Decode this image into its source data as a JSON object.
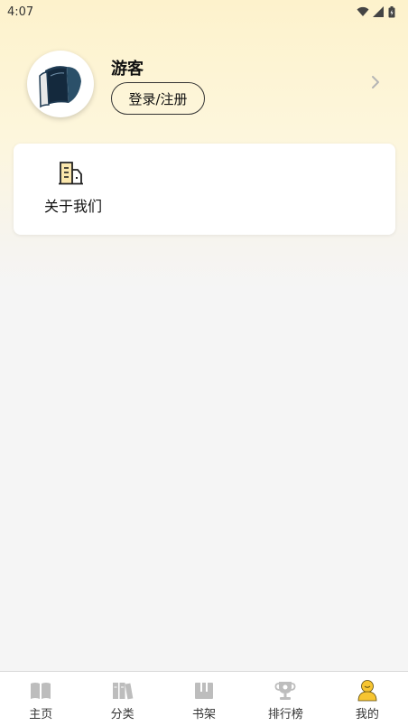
{
  "status_bar": {
    "time": "4:07"
  },
  "profile": {
    "username": "游客",
    "login_label": "登录/注册"
  },
  "menu": {
    "about_label": "关于我们"
  },
  "tabbar": {
    "tabs": [
      {
        "label": "主页",
        "icon": "book-open-icon",
        "active": false
      },
      {
        "label": "分类",
        "icon": "category-books-icon",
        "active": false
      },
      {
        "label": "书架",
        "icon": "bookshelf-icon",
        "active": false
      },
      {
        "label": "排行榜",
        "icon": "trophy-icon",
        "active": false
      },
      {
        "label": "我的",
        "icon": "user-icon",
        "active": true
      }
    ]
  },
  "colors": {
    "accent": "#f7c531",
    "inactive_icon": "#b9b9b9",
    "header_gradient_top": "#fdf2cc"
  }
}
